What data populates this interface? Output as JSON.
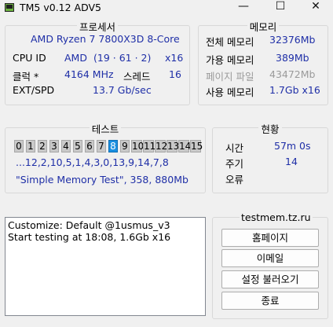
{
  "window": {
    "title": "TM5 v0.12 ADV5",
    "min_symbol": "—",
    "max_symbol": "☐",
    "close_symbol": "✕"
  },
  "processor": {
    "group_title": "프로세서",
    "cpu_name": "AMD Ryzen 7 7800X3D 8-Core",
    "cpuid_label": "CPU ID",
    "cpuid_vendor": "AMD",
    "cpuid_value": "(19 · 61 · 2)",
    "cpuid_threads": "x16",
    "clock_label": "클럭 *",
    "clock_value": "4164 MHz",
    "threads_label": "스레드",
    "threads_value": "16",
    "ext_label": "EXT/SPD",
    "ext_value": "13.7 Gb/sec"
  },
  "memory": {
    "group_title": "메모리",
    "total_label": "전체 메모리",
    "total_value": "32376Mb",
    "avail_label": "가용 메모리",
    "avail_value": "389Mb",
    "page_label": "페이지 파일",
    "page_value": "43472Mb",
    "used_label": "사용 메모리",
    "used_value": "1.7Gb x16"
  },
  "test": {
    "group_title": "테스트",
    "cells": [
      "0",
      "1",
      "2",
      "3",
      "4",
      "5",
      "6",
      "7",
      "8",
      "9",
      "10",
      "11",
      "12",
      "13",
      "14",
      "15"
    ],
    "active_index": 8,
    "sequence": "...12,2,10,5,1,4,3,0,13,9,14,7,8",
    "description": "\"Simple Memory Test\", 358, 880Mb"
  },
  "status": {
    "group_title": "현황",
    "time_label": "시간",
    "time_value": "57m 0s",
    "cycle_label": "주기",
    "cycle_value": "14",
    "error_label": "오류",
    "error_value": ""
  },
  "log": {
    "lines": [
      "Customize: Default @1usmus_v3",
      "Start testing at 18:08, 1.6Gb x16"
    ]
  },
  "side": {
    "site": "testmem.tz.ru",
    "buttons": [
      "홈페이지",
      "이메일",
      "설정 불러오기",
      "종료"
    ]
  },
  "colors": {
    "value_text": "#1f2fa7",
    "active_cell": "#1a8fe0",
    "inactive_cell": "#c9c9c9",
    "dim_text": "#9a9a9a"
  }
}
